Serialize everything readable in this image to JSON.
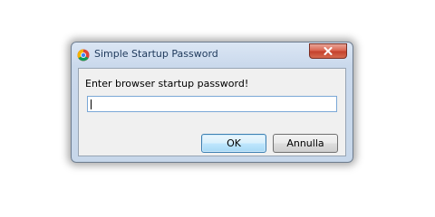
{
  "window": {
    "title": "Simple Startup Password",
    "icon": "chrome-icon",
    "close_icon": "close-icon"
  },
  "dialog": {
    "prompt": "Enter browser startup password!",
    "password_value": "",
    "ok_label": "OK",
    "cancel_label": "Annulla"
  },
  "colors": {
    "close_button": "#c4402b",
    "ok_button_border": "#3c7fb1",
    "frame": "#c7d7ea"
  }
}
